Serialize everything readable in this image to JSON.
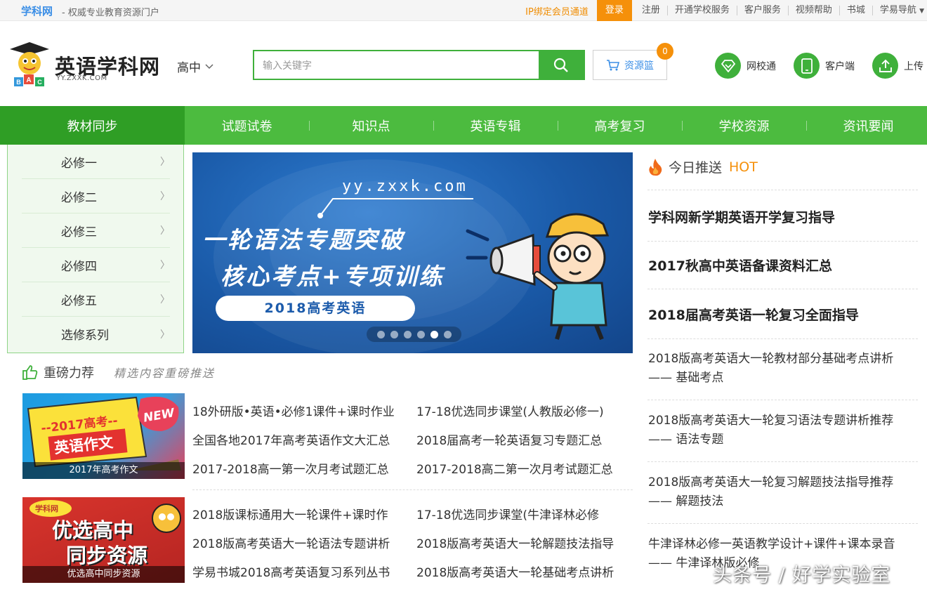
{
  "topbar": {
    "brand": "学科网",
    "slogan": "- 权威专业教育资源门户",
    "ip_channel": "IP绑定会员通道",
    "login": "登录",
    "register": "注册",
    "school_service": "开通学校服务",
    "customer_service": "客户服务",
    "video_help": "视频帮助",
    "bookstore": "书城",
    "nav": "学易导航"
  },
  "header": {
    "logo_title": "英语学科网",
    "logo_url": "YY.ZXXK.COM",
    "level": "高中",
    "search_placeholder": "输入关键字",
    "basket_label": "资源篮",
    "basket_count": "0",
    "wangxiaotong": "网校通",
    "client": "客户端",
    "upload": "上传"
  },
  "nav": [
    "教材同步",
    "试题试卷",
    "知识点",
    "英语专辑",
    "高考复习",
    "学校资源",
    "资讯要闻"
  ],
  "sidebar": [
    "必修一",
    "必修二",
    "必修三",
    "必修四",
    "必修五",
    "选修系列"
  ],
  "banner": {
    "url": "yy.zxxk.com",
    "line1": "一轮语法专题突破",
    "line2": "核心考点+专项训练",
    "pill": "2018高考英语",
    "active_dot": 5
  },
  "recommend": {
    "title": "重磅力荐",
    "subtitle": "精选内容重磅推送",
    "blocks": [
      {
        "image_caption": "2017年高考作文",
        "image_line1": "--2017高考--",
        "image_line2": "英语作文",
        "image_badge": "NEW",
        "left": [
          "18外研版•英语•必修1课件+课时作业",
          "全国各地2017年高考英语作文大汇总",
          "2017-2018高一第一次月考试题汇总"
        ],
        "right": [
          "17-18优选同步课堂(人教版必修一)",
          "2018届高考一轮英语复习专题汇总",
          "2017-2018高二第一次月考试题汇总"
        ]
      },
      {
        "image_caption": "优选高中同步资源",
        "image_line1": "优选高中",
        "image_line2": "同步资源",
        "image_badge": "学科网",
        "left": [
          "2018版课标通用大一轮课件+课时作",
          "2018版高考英语大一轮语法专题讲析",
          "学易书城2018高考英语复习系列丛书"
        ],
        "right": [
          "17-18优选同步课堂(牛津译林必修",
          "2018版高考英语大一轮解题技法指导",
          "2018版高考英语大一轮基础考点讲析"
        ]
      }
    ]
  },
  "hot": {
    "title": "今日推送",
    "tag": "HOT",
    "headlines": [
      "学科网新学期英语开学复习指导",
      "2017秋高中英语备课资料汇总",
      "2018届高考英语一轮复习全面指导"
    ],
    "items": [
      {
        "line1": "2018版高考英语大一轮教材部分基础考点讲析",
        "line2": "—— 基础考点"
      },
      {
        "line1": "2018版高考英语大一轮复习语法专题讲析推荐",
        "line2": "—— 语法专题"
      },
      {
        "line1": "2018版高考英语大一轮复习解题技法指导推荐",
        "line2": "—— 解题技法"
      },
      {
        "line1": "牛津译林必修一英语教学设计+课件+课本录音",
        "line2": "—— 牛津译林版必修"
      }
    ]
  },
  "watermark": "头条号 / 好学实验室",
  "colors": {
    "green": "#4cbb3f",
    "dark_green": "#2f9e25",
    "orange": "#f5900a",
    "blue": "#3a8ee6"
  }
}
